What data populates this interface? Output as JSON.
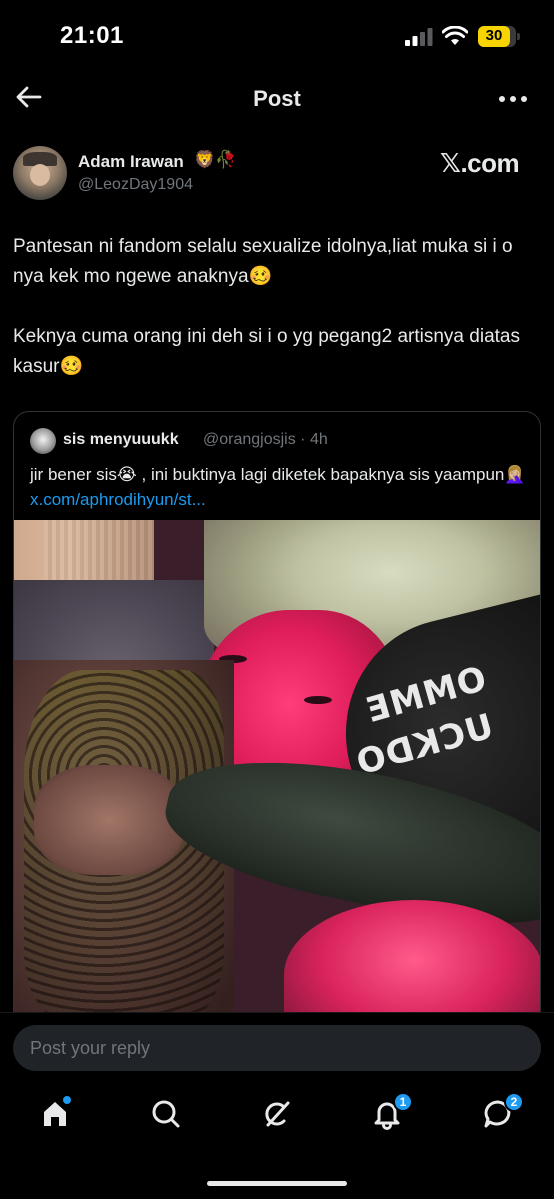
{
  "status_bar": {
    "time": "21:01",
    "battery": "30",
    "battery_color": "#f7d300"
  },
  "nav": {
    "title": "Post",
    "back_icon": "arrow-left-icon",
    "more_icon": "more-horizontal-icon"
  },
  "post": {
    "author_name": "Adam Irawan",
    "author_emojis": "🦁🥀",
    "author_handle": "@LeozDay1904",
    "source": "𝕏.com",
    "paragraphs": [
      "Pantesan ni fandom selalu sexualize idolnya,liat muka si i o nya kek mo ngewe anaknya🥴",
      "Keknya cuma orang ini deh si i o yg pegang2 artisnya diatas kasur🥴"
    ]
  },
  "quote": {
    "name": "sis menyuuukk",
    "meta": "@orangjosjis · 4h",
    "text": "jir bener sis😭 , ini buktinya lagi diketek bapaknya sis yaampun🤦🏼‍♀️ ",
    "link": "x.com/aphrodihyun/st...",
    "media_logo_line1": "OMME",
    "media_logo_line2": "UCKDO"
  },
  "reply": {
    "placeholder": "Post your reply"
  },
  "tabbar": {
    "items": [
      {
        "name": "Home",
        "icon": "home-icon"
      },
      {
        "name": "Search",
        "icon": "search-icon"
      },
      {
        "name": "Grok",
        "icon": "grok-icon"
      },
      {
        "name": "Notifications",
        "icon": "bell-icon",
        "badge": "1"
      },
      {
        "name": "Messages",
        "icon": "message-icon",
        "badge": "2"
      }
    ],
    "accent": "#1d9bf0"
  }
}
